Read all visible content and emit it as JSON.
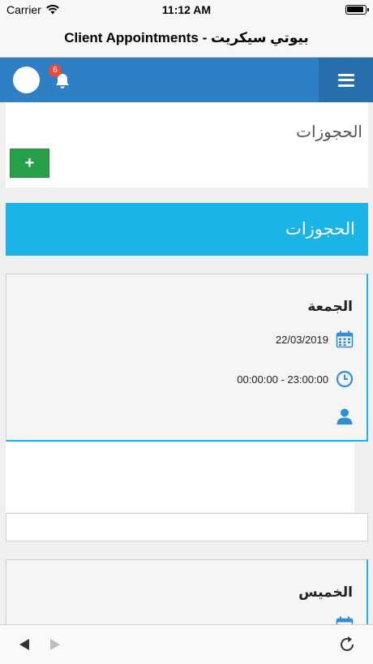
{
  "status_bar": {
    "carrier": "Carrier",
    "time": "11:12 AM"
  },
  "window": {
    "title": "بيوتي سيكريت - Client Appointments"
  },
  "header": {
    "notification_count": "6"
  },
  "section": {
    "title": "الحجوزات",
    "add_label": "+"
  },
  "banner": {
    "title": "الحجوزات"
  },
  "appointments": [
    {
      "day": "الجمعة",
      "date": "22/03/2019",
      "time_range": "00:00:00 - 23:00:00"
    },
    {
      "day": "الخميس"
    }
  ],
  "colors": {
    "header": "#2e7fc3",
    "banner": "#1bb4e6",
    "add_button": "#27a04a",
    "badge": "#e84c3d"
  },
  "icons": [
    "wifi-icon",
    "battery-icon",
    "avatar",
    "bell-icon",
    "menu-icon",
    "plus-icon",
    "calendar-icon",
    "clock-icon",
    "user-icon",
    "back-icon",
    "forward-icon",
    "reload-icon"
  ]
}
